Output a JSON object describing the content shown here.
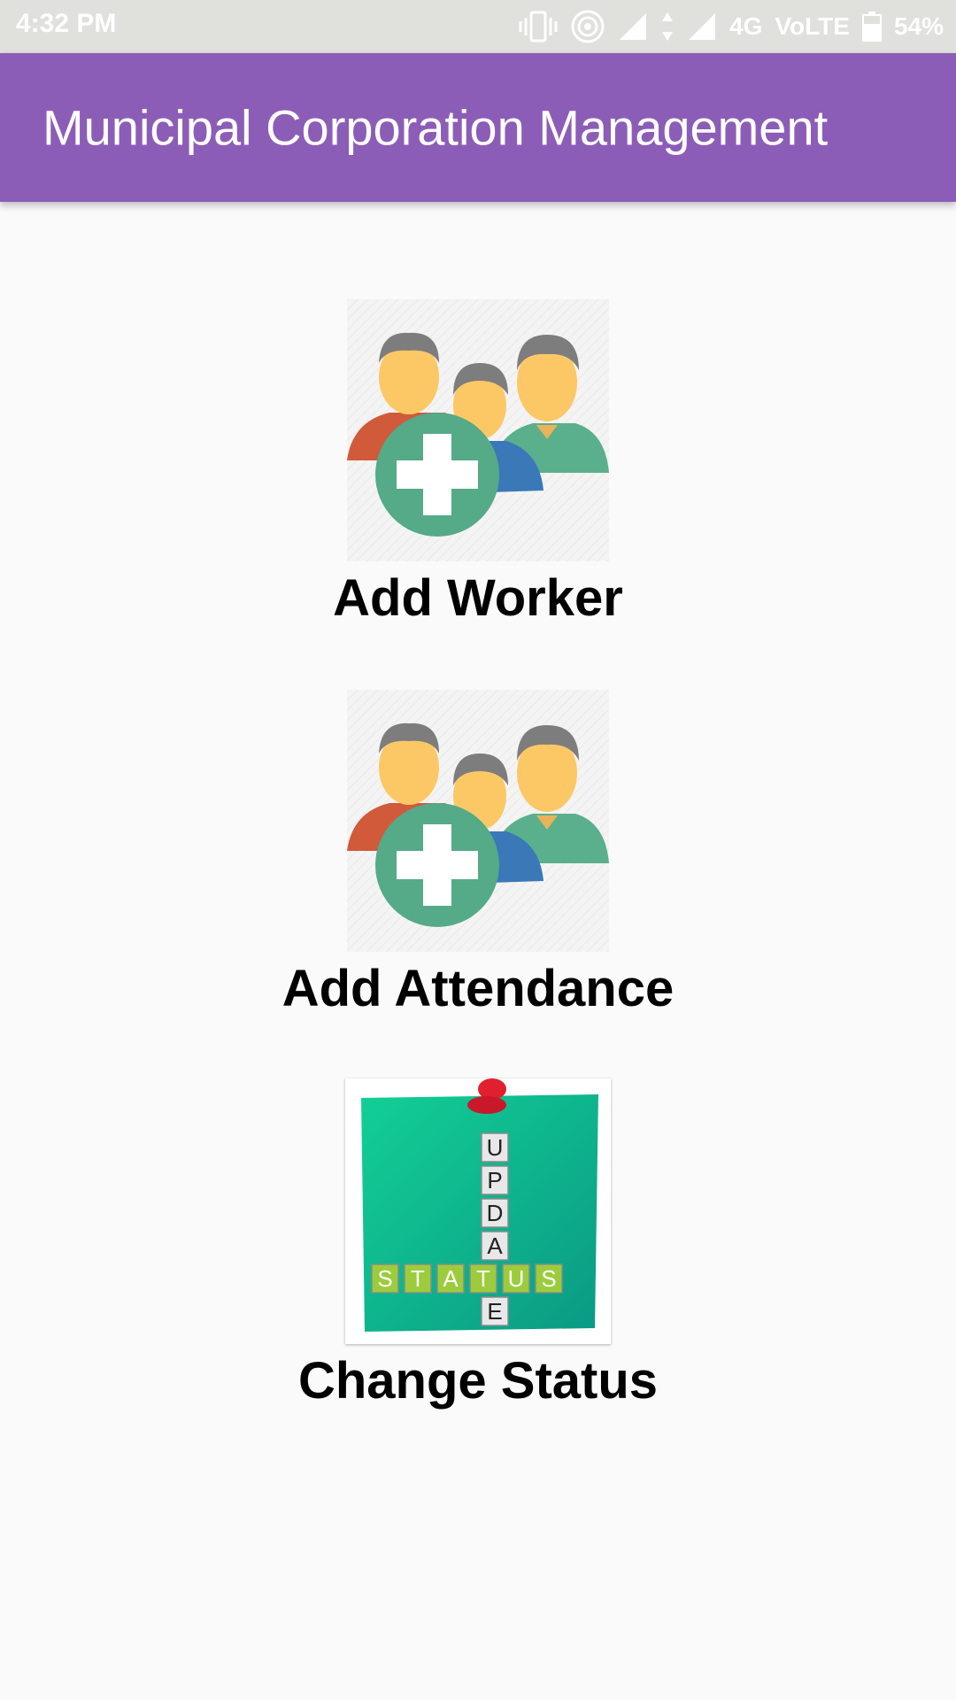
{
  "status_bar": {
    "time": "4:32 PM",
    "network": "4G",
    "volte": "VoLTE",
    "battery": "54%"
  },
  "app_bar": {
    "title": "Municipal Corporation Management"
  },
  "menu": {
    "items": [
      {
        "label": "Add Worker",
        "icon": "add-worker-icon"
      },
      {
        "label": "Add Attendance",
        "icon": "add-attendance-icon"
      },
      {
        "label": "Change Status",
        "icon": "update-status-icon"
      }
    ]
  },
  "update_tiles": {
    "vertical": [
      "U",
      "P",
      "D",
      "A",
      "T",
      "E"
    ],
    "horizontal": [
      "S",
      "T",
      "A",
      "T",
      "U",
      "S"
    ]
  },
  "colors": {
    "app_bar": "#8c5db7",
    "status_bar": "#e0e0dc",
    "background": "#fafafa",
    "plus_circle": "#55aa88"
  }
}
